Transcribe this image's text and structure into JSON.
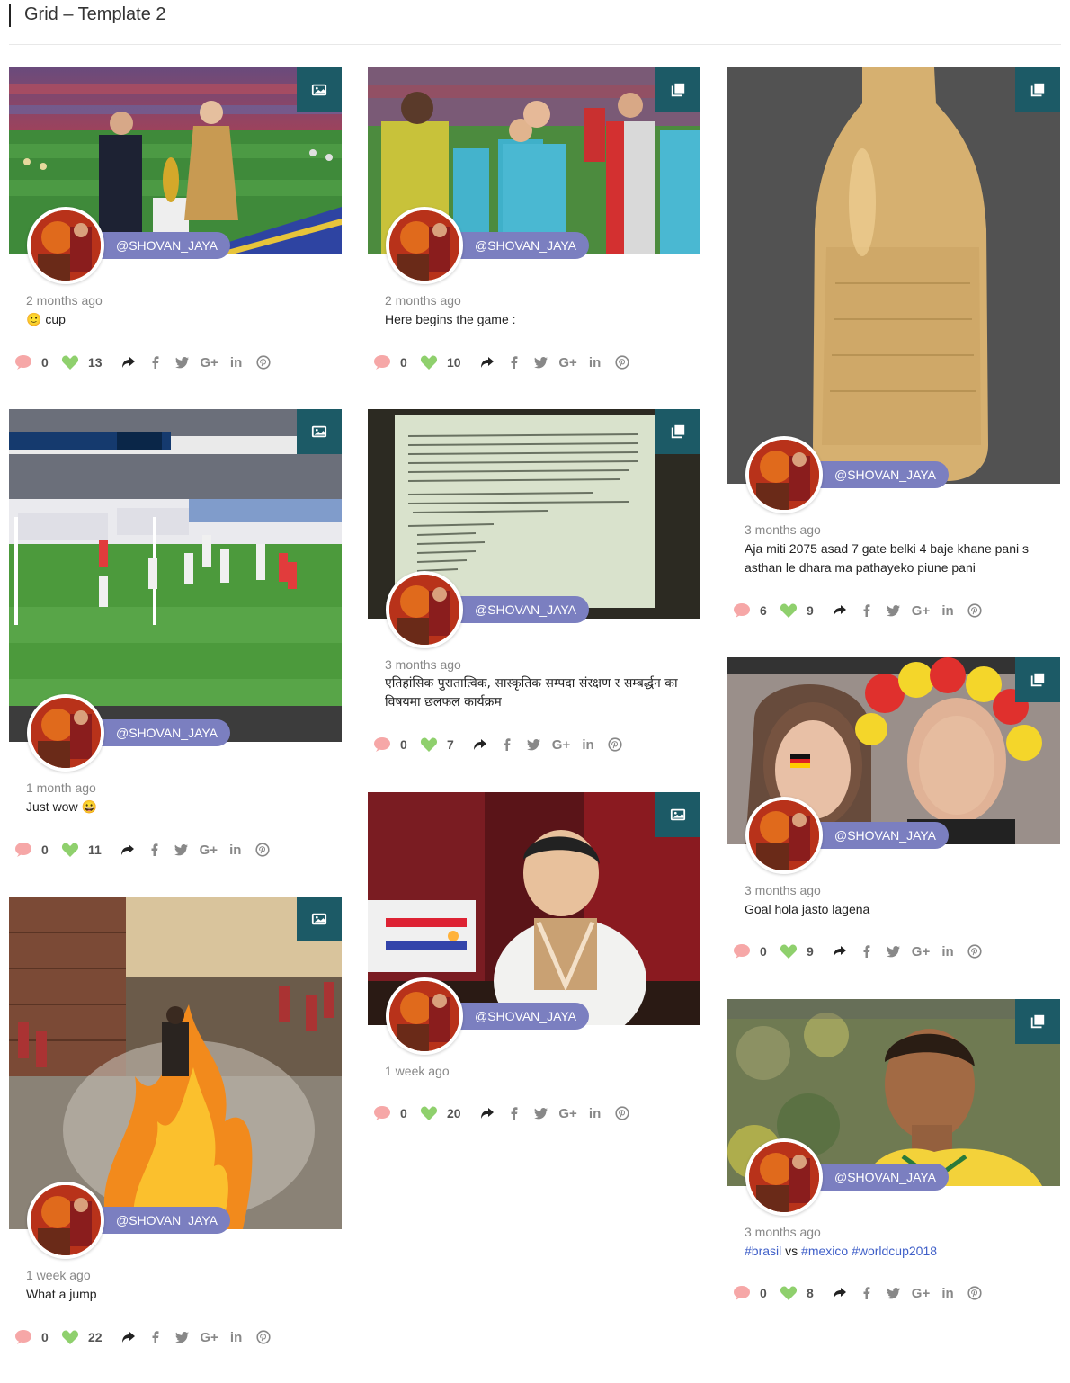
{
  "page": {
    "title": "Grid – Template 2"
  },
  "colors": {
    "badge": "#1c5a66",
    "handle": "#7b7fc0",
    "comment": "#f6a7a7",
    "like": "#8fd06d",
    "hashtag": "#3f5fc8"
  },
  "icons": {
    "photo_type": "image-icon",
    "album_type": "gallery-icon",
    "comment": "comment-bubble-icon",
    "like": "heart-icon",
    "share": "share-arrow-icon",
    "facebook": "facebook-icon",
    "twitter": "twitter-icon",
    "googleplus": "google-plus-icon",
    "linkedin": "linkedin-icon",
    "pinterest": "pinterest-icon"
  },
  "posts": [
    {
      "handle": "@SHOVAN_JAYA",
      "time": "2 months ago",
      "caption": "🙂 cup",
      "comments": "0",
      "likes": "13",
      "type": "image"
    },
    {
      "handle": "@SHOVAN_JAYA",
      "time": "2 months ago",
      "caption": "Here begins the game :",
      "comments": "0",
      "likes": "10",
      "type": "gallery"
    },
    {
      "handle": "@SHOVAN_JAYA",
      "time": "3 months ago",
      "caption": "Aja miti 2075 asad 7 gate belki 4 baje khane pani s asthan le dhara ma pathayeko piune pani",
      "comments": "6",
      "likes": "9",
      "type": "gallery"
    },
    {
      "handle": "@SHOVAN_JAYA",
      "time": "1 month ago",
      "caption": "Just wow 😀",
      "comments": "0",
      "likes": "11",
      "type": "image"
    },
    {
      "handle": "@SHOVAN_JAYA",
      "time": "3 months ago",
      "caption": "एतिहांसिक पुरातात्विक, सास्कृतिक सम्पदा संरक्षण र सम्बर्द्धन का विषयमा छलफल कार्यक्रम",
      "comments": "0",
      "likes": "7",
      "type": "gallery"
    },
    {
      "handle": "@SHOVAN_JAYA",
      "time": "3 months ago",
      "caption": "Goal hola jasto lagena",
      "comments": "0",
      "likes": "9",
      "type": "gallery"
    },
    {
      "handle": "@SHOVAN_JAYA",
      "time": "1 week ago",
      "caption": "",
      "comments": "0",
      "likes": "20",
      "type": "image"
    },
    {
      "handle": "@SHOVAN_JAYA",
      "time": "1 week ago",
      "caption": "What a jump",
      "comments": "0",
      "likes": "22",
      "type": "image"
    },
    {
      "handle": "@SHOVAN_JAYA",
      "time": "3 months ago",
      "caption_parts": [
        "#brasil",
        " vs ",
        "#mexico",
        " ",
        "#worldcup2018"
      ],
      "comments": "0",
      "likes": "8",
      "type": "gallery"
    }
  ]
}
